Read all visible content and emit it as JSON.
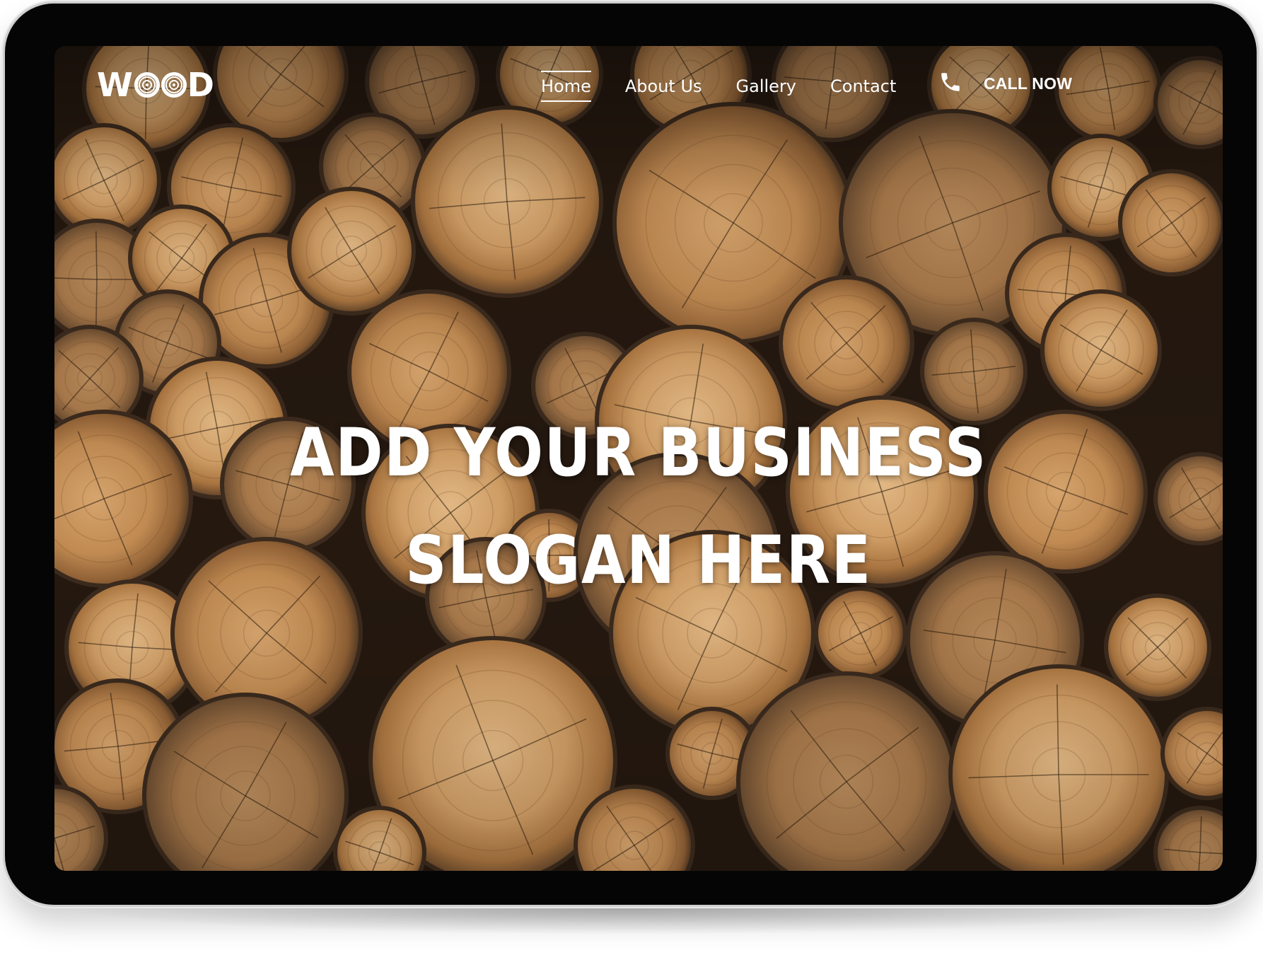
{
  "logo": {
    "text": "WOOD"
  },
  "nav": {
    "items": [
      {
        "label": "Home",
        "active": true
      },
      {
        "label": "About Us",
        "active": false
      },
      {
        "label": "Gallery",
        "active": false
      },
      {
        "label": "Contact",
        "active": false
      }
    ]
  },
  "cta": {
    "label": "CALL NOW",
    "icon": "phone-icon"
  },
  "hero": {
    "line1": "ADD YOUR BUSINESS",
    "line2": "SLOGAN HERE",
    "background": "stacked-log-cross-sections-photo"
  },
  "colors": {
    "text": "#ffffff",
    "wood_light": "#d9ab76",
    "wood_mid": "#b9864f",
    "bark": "#4a3526",
    "background_dark": "#2a1d12"
  }
}
